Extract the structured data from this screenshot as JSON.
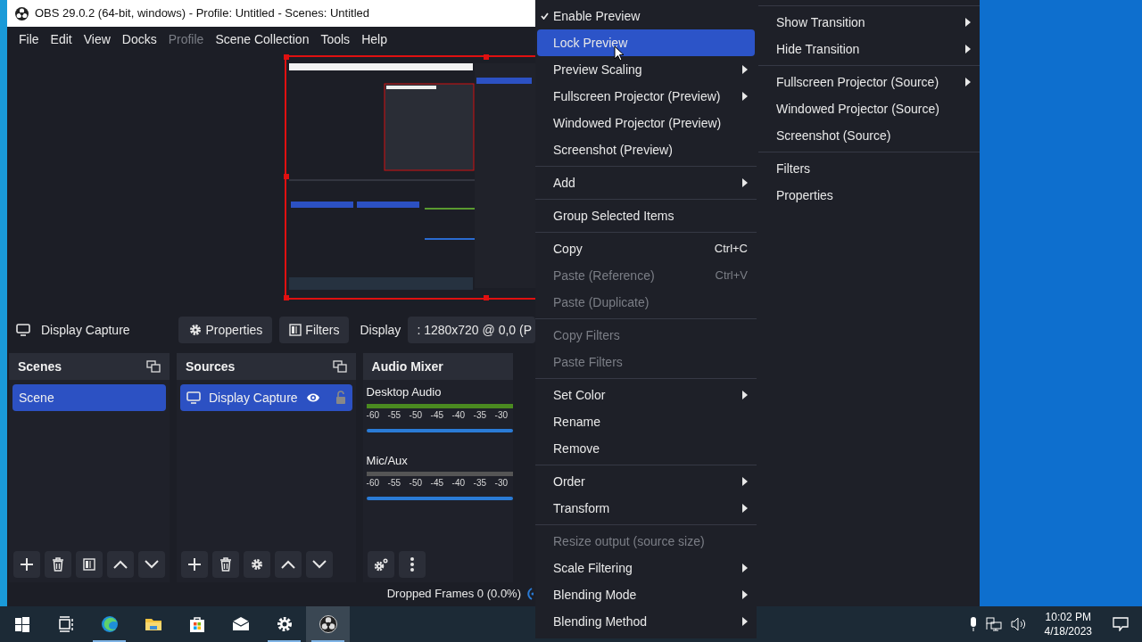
{
  "window": {
    "title": "OBS 29.0.2 (64-bit, windows) - Profile: Untitled - Scenes: Untitled"
  },
  "menu_bar": [
    {
      "label": "File",
      "disabled": false
    },
    {
      "label": "Edit",
      "disabled": false
    },
    {
      "label": "View",
      "disabled": false
    },
    {
      "label": "Docks",
      "disabled": false
    },
    {
      "label": "Profile",
      "disabled": true
    },
    {
      "label": "Scene Collection",
      "disabled": false
    },
    {
      "label": "Tools",
      "disabled": false
    },
    {
      "label": "Help",
      "disabled": false
    }
  ],
  "source_toolbar": {
    "source": "Display Capture",
    "buttons": [
      {
        "kind": "properties",
        "label": "Properties"
      },
      {
        "kind": "filters",
        "label": "Filters"
      }
    ],
    "display_label": "Display",
    "display_value": ": 1280x720 @ 0,0 (P"
  },
  "scenes": {
    "title": "Scenes",
    "items": [
      {
        "label": "Scene",
        "selected": true
      }
    ]
  },
  "sources": {
    "title": "Sources",
    "items": [
      {
        "label": "Display Capture",
        "selected": true,
        "visible": true,
        "locked": false
      }
    ]
  },
  "audio_mixer": {
    "title": "Audio Mixer",
    "channels": [
      {
        "name": "Desktop Audio",
        "scale": [
          "-60",
          "-55",
          "-50",
          "-45",
          "-40",
          "-35",
          "-30"
        ],
        "active": true
      },
      {
        "name": "Mic/Aux",
        "scale": [
          "-60",
          "-55",
          "-50",
          "-45",
          "-40",
          "-35",
          "-30"
        ],
        "active": false
      }
    ]
  },
  "status_bar": {
    "dropped_frames": "Dropped Frames 0 (0.0%)"
  },
  "context_menu": {
    "column_1": [
      {
        "kind": "item",
        "label": "Enable Preview",
        "checked": true,
        "selected": false,
        "disabled": false,
        "submenu": false
      },
      {
        "kind": "item",
        "label": "Lock Preview",
        "checked": false,
        "selected": true,
        "disabled": false,
        "submenu": false
      },
      {
        "kind": "item",
        "label": "Preview Scaling",
        "checked": false,
        "selected": false,
        "disabled": false,
        "submenu": true
      },
      {
        "kind": "item",
        "label": "Fullscreen Projector (Preview)",
        "checked": false,
        "selected": false,
        "disabled": false,
        "submenu": true
      },
      {
        "kind": "item",
        "label": "Windowed Projector (Preview)",
        "checked": false,
        "selected": false,
        "disabled": false,
        "submenu": false
      },
      {
        "kind": "item",
        "label": "Screenshot (Preview)",
        "checked": false,
        "selected": false,
        "disabled": false,
        "submenu": false
      },
      {
        "kind": "separator"
      },
      {
        "kind": "item",
        "label": "Add",
        "checked": false,
        "selected": false,
        "disabled": false,
        "submenu": true
      },
      {
        "kind": "separator"
      },
      {
        "kind": "item",
        "label": "Group Selected Items",
        "checked": false,
        "selected": false,
        "disabled": false,
        "submenu": false
      },
      {
        "kind": "separator"
      },
      {
        "kind": "item",
        "label": "Copy",
        "shortcut": "Ctrl+C",
        "checked": false,
        "selected": false,
        "disabled": false,
        "submenu": false
      },
      {
        "kind": "item",
        "label": "Paste (Reference)",
        "shortcut": "Ctrl+V",
        "checked": false,
        "selected": false,
        "disabled": true,
        "submenu": false
      },
      {
        "kind": "item",
        "label": "Paste (Duplicate)",
        "checked": false,
        "selected": false,
        "disabled": true,
        "submenu": false
      },
      {
        "kind": "separator"
      },
      {
        "kind": "item",
        "label": "Copy Filters",
        "checked": false,
        "selected": false,
        "disabled": true,
        "submenu": false
      },
      {
        "kind": "item",
        "label": "Paste Filters",
        "checked": false,
        "selected": false,
        "disabled": true,
        "submenu": false
      },
      {
        "kind": "separator"
      },
      {
        "kind": "item",
        "label": "Set Color",
        "checked": false,
        "selected": false,
        "disabled": false,
        "submenu": true
      },
      {
        "kind": "item",
        "label": "Rename",
        "checked": false,
        "selected": false,
        "disabled": false,
        "submenu": false
      },
      {
        "kind": "item",
        "label": "Remove",
        "checked": false,
        "selected": false,
        "disabled": false,
        "submenu": false
      },
      {
        "kind": "separator"
      },
      {
        "kind": "item",
        "label": "Order",
        "checked": false,
        "selected": false,
        "disabled": false,
        "submenu": true
      },
      {
        "kind": "item",
        "label": "Transform",
        "checked": false,
        "selected": false,
        "disabled": false,
        "submenu": true
      },
      {
        "kind": "separator"
      },
      {
        "kind": "item",
        "label": "Resize output (source size)",
        "checked": false,
        "selected": false,
        "disabled": true,
        "submenu": false
      },
      {
        "kind": "item",
        "label": "Scale Filtering",
        "checked": false,
        "selected": false,
        "disabled": false,
        "submenu": true
      },
      {
        "kind": "item",
        "label": "Blending Mode",
        "checked": false,
        "selected": false,
        "disabled": false,
        "submenu": true
      },
      {
        "kind": "item",
        "label": "Blending Method",
        "checked": false,
        "selected": false,
        "disabled": false,
        "submenu": true
      }
    ],
    "column_2": [
      {
        "kind": "separator"
      },
      {
        "kind": "item",
        "label": "Show Transition",
        "checked": false,
        "selected": false,
        "disabled": false,
        "submenu": true
      },
      {
        "kind": "item",
        "label": "Hide Transition",
        "checked": false,
        "selected": false,
        "disabled": false,
        "submenu": true
      },
      {
        "kind": "separator"
      },
      {
        "kind": "item",
        "label": "Fullscreen Projector (Source)",
        "checked": false,
        "selected": false,
        "disabled": false,
        "submenu": true
      },
      {
        "kind": "item",
        "label": "Windowed Projector (Source)",
        "checked": false,
        "selected": false,
        "disabled": false,
        "submenu": false
      },
      {
        "kind": "item",
        "label": "Screenshot (Source)",
        "checked": false,
        "selected": false,
        "disabled": false,
        "submenu": false
      },
      {
        "kind": "separator"
      },
      {
        "kind": "item",
        "label": "Filters",
        "checked": false,
        "selected": false,
        "disabled": false,
        "submenu": false
      },
      {
        "kind": "item",
        "label": "Properties",
        "checked": false,
        "selected": false,
        "disabled": false,
        "submenu": false
      }
    ]
  },
  "taskbar": {
    "apps": [
      {
        "kind": "start",
        "running": false,
        "selected": false
      },
      {
        "kind": "task_view",
        "running": false,
        "selected": false
      },
      {
        "kind": "browser",
        "running": true,
        "selected": false
      },
      {
        "kind": "folder",
        "running": false,
        "selected": false
      },
      {
        "kind": "store",
        "running": false,
        "selected": false
      },
      {
        "kind": "mail",
        "running": false,
        "selected": false
      },
      {
        "kind": "settings",
        "running": true,
        "selected": false
      },
      {
        "kind": "obs",
        "running": true,
        "selected": true
      }
    ],
    "time": "10:02 PM",
    "date": "4/18/2023"
  }
}
